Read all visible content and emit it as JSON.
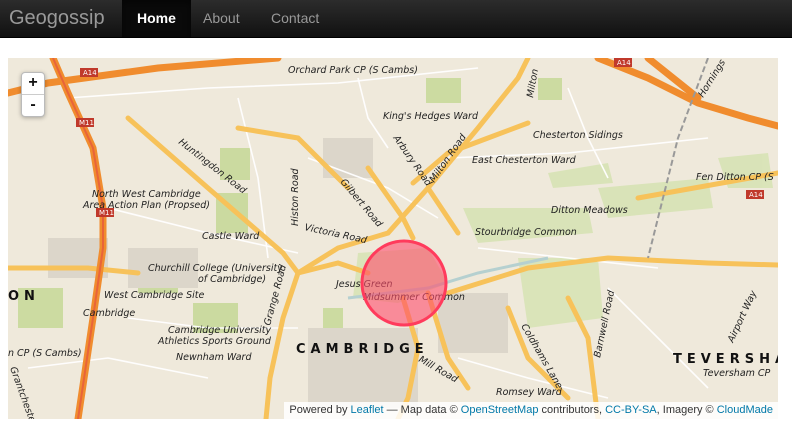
{
  "navbar": {
    "brand": "Geogossip",
    "items": [
      {
        "label": "Home",
        "active": true
      },
      {
        "label": "About",
        "active": false
      },
      {
        "label": "Contact",
        "active": false
      }
    ]
  },
  "map": {
    "zoom_in": "+",
    "zoom_out": "-",
    "labels": {
      "orchard_park": "Orchard Park CP (S Cambs)",
      "kings_hedges": "King's Hedges Ward",
      "chesterton_sidings": "Chesterton Sidings",
      "east_chesterton": "East Chesterton Ward",
      "fen_ditton": "Fen Ditton CP (S",
      "nw_cambridge_1": "North West Cambridge",
      "nw_cambridge_2": "Area Action Plan (Propsed)",
      "huntingdon_road": "Huntingdon Road",
      "histon_road": "Histon Road",
      "gilbert_road": "Gilbert Road",
      "arbury_road": "Arbury Road",
      "milton_road": "Milton Road",
      "milton": "Milton",
      "ditton_meadows": "Ditton Meadows",
      "castle_ward": "Castle Ward",
      "victoria_road": "Victoria Road",
      "stourbridge_common": "Stourbridge Common",
      "churchill_1": "Churchill College (University",
      "churchill_2": "of Cambridge)",
      "jesus_green": "Jesus Green",
      "midsummer_common": "Midsummer Common",
      "west_cambridge": "West Cambridge Site",
      "on": "ON",
      "cambridge_small": "Cambridge",
      "grange_road": "Grange Road",
      "cu_sports_1": "Cambridge University",
      "cu_sports_2": "Athletics Sports Ground",
      "newnham_ward": "Newnham Ward",
      "cambridge_big": "CAMBRIDGE",
      "coldhams_lane": "Coldhams Lane",
      "barnwell_road": "Barnwell Road",
      "airport_way": "Airport Way",
      "teversham": "TEVERSHA",
      "teversham_cp": "Teversham CP",
      "s_cambs": "n CP (S Cambs)",
      "grantchester": "Grantchester",
      "mill_road": "Mill Road",
      "romsey_ward": "Romsey Ward",
      "hornings": "Hornings",
      "a14_left": "A14",
      "a14_right": "A14",
      "a14_far": "A14",
      "m11_top": "M11",
      "m11_mid": "M11"
    },
    "marker_color": "#ff4d6d",
    "attribution": {
      "prefix": "Powered by",
      "leaflet": "Leaflet",
      "mid1": "— Map data ©",
      "osm": "OpenStreetMap",
      "mid2": "contributors,",
      "ccbysa": "CC-BY-SA",
      "mid3": ", Imagery ©",
      "cloudmade": "CloudMade"
    }
  }
}
